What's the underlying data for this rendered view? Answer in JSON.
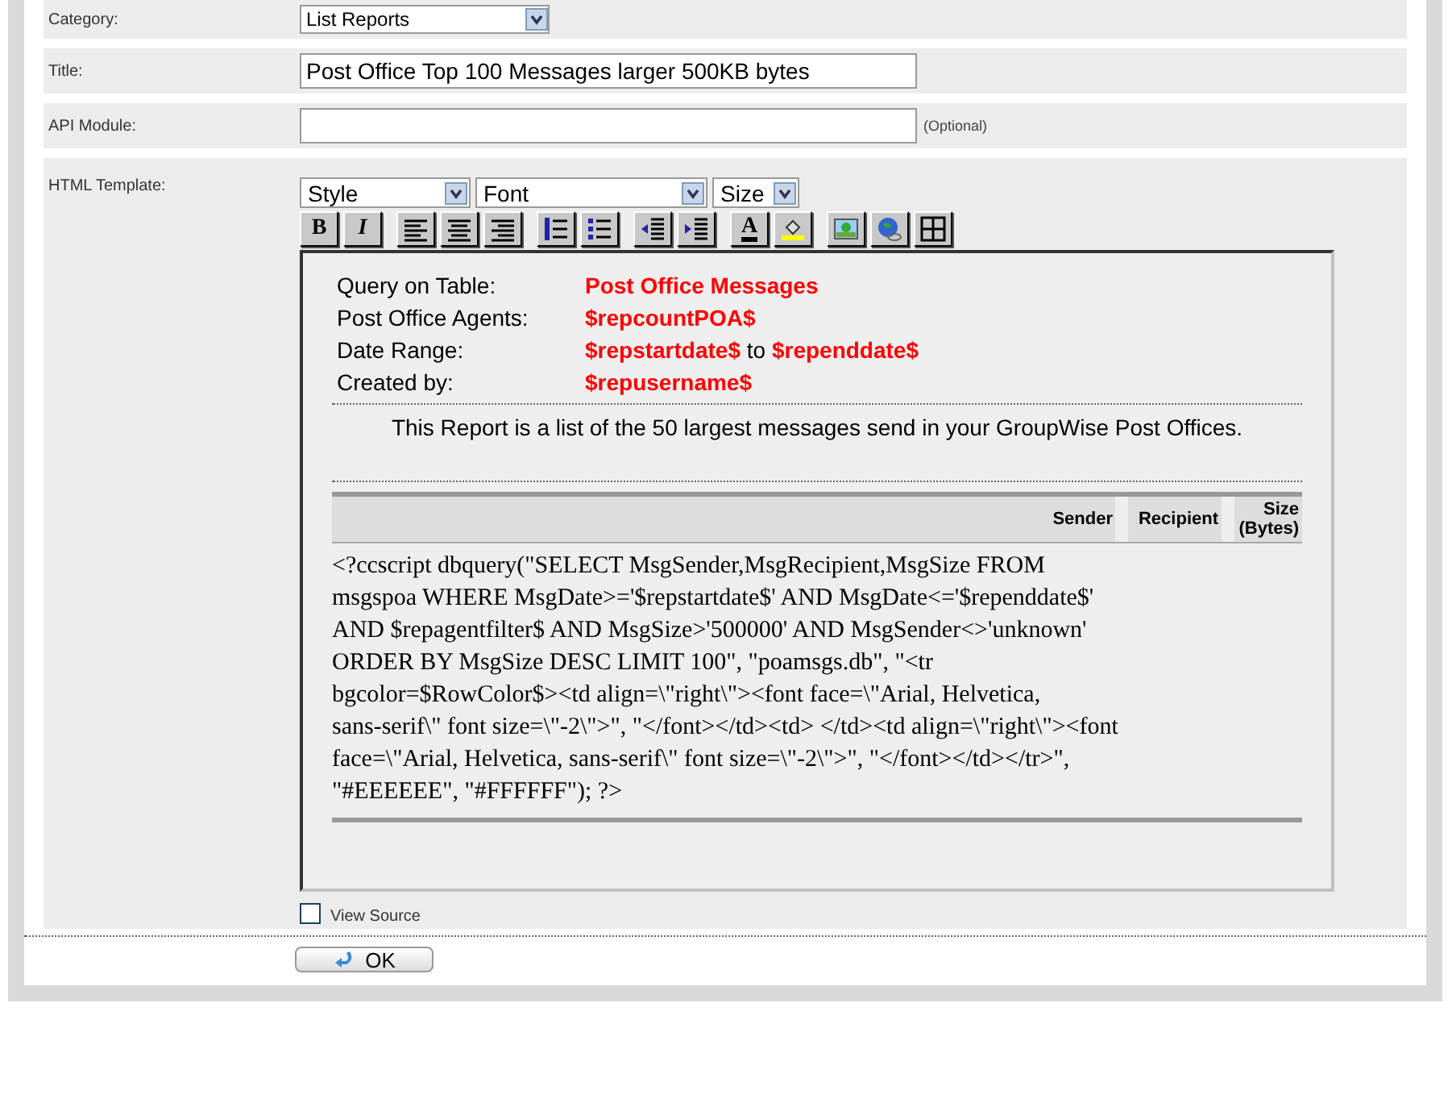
{
  "fields": [
    {
      "label": "Category:",
      "kind": "select",
      "value": "List Reports"
    },
    {
      "label": "Title:",
      "kind": "text",
      "value": "Post Office Top 100 Messages larger 500KB bytes"
    },
    {
      "label": "API Module:",
      "kind": "text",
      "hint": "(Optional)"
    }
  ],
  "editor": {
    "label": "HTML Template:",
    "dropdowns": [
      "Style",
      "Font",
      "Size"
    ],
    "buttons": [
      {
        "kind": "bold",
        "label": "B"
      },
      {
        "kind": "italic",
        "label": "I"
      },
      {
        "kind": "align-left"
      },
      {
        "kind": "align-center"
      },
      {
        "kind": "align-right"
      },
      {
        "kind": "ordered-list"
      },
      {
        "kind": "bullet-list"
      },
      {
        "kind": "outdent"
      },
      {
        "kind": "indent"
      },
      {
        "kind": "text-color",
        "label": "A"
      },
      {
        "kind": "highlight"
      },
      {
        "kind": "image"
      },
      {
        "kind": "link"
      },
      {
        "kind": "table"
      }
    ],
    "info": [
      {
        "kind": "single",
        "label": "Query on Table:",
        "value": "Post Office Messages"
      },
      {
        "kind": "single",
        "label": "Post Office Agents:",
        "value": "$repcountPOA$"
      },
      {
        "kind": "range",
        "label": "Date Range:",
        "start": "$repstartdate$",
        "joiner": "to",
        "end": "$rependdate$"
      },
      {
        "kind": "single",
        "label": "Created by:",
        "value": "$repusername$"
      }
    ],
    "description": "This Report is a list of the 50 largest messages send in your GroupWise Post Offices.",
    "columns": [
      "Sender",
      "Recipient",
      "Size (Bytes)"
    ],
    "code_lines": [
      "<?ccscript dbquery(\"SELECT MsgSender,MsgRecipient,MsgSize FROM",
      "msgspoa WHERE MsgDate>='$repstartdate$' AND MsgDate<='$rependdate$'",
      "AND $repagentfilter$ AND MsgSize>'500000' AND MsgSender<>'unknown'",
      "ORDER BY MsgSize DESC LIMIT 100\", \"poamsgs.db\", \"<tr",
      "bgcolor=$RowColor$><td align=\\\"right\\\"><font face=\\\"Arial, Helvetica,",
      "sans-serif\\\" font size=\\\"-2\\\">\", \"</font></td><td> </td><td align=\\\"right\\\"><font",
      "face=\\\"Arial, Helvetica, sans-serif\\\" font size=\\\"-2\\\">\", \"</font></td></tr>\",",
      "\"#EEEEEE\", \"#FFFFFF\"); ?>"
    ]
  },
  "view_source": {
    "label": "View Source",
    "checked": false
  },
  "ok_button": "OK"
}
